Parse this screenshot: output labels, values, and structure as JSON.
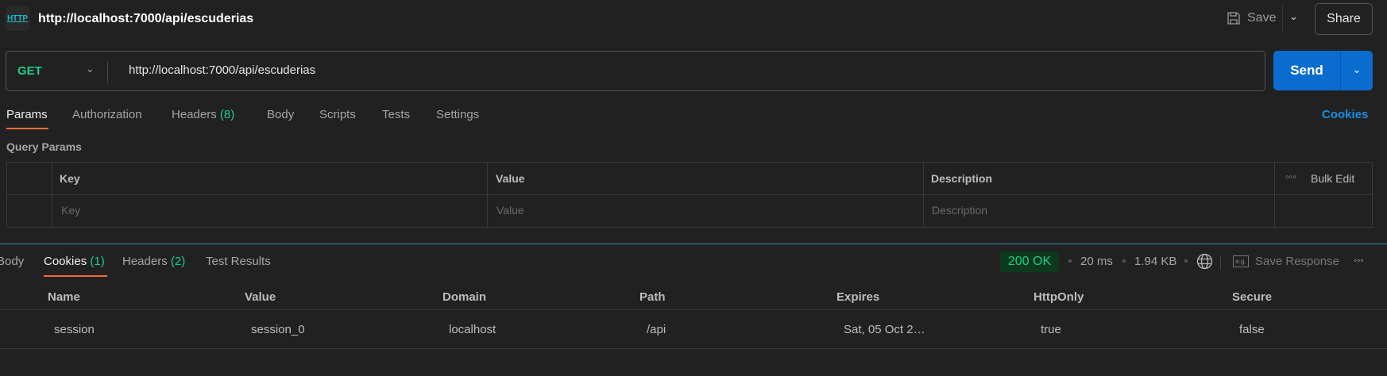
{
  "header": {
    "icon_text": "HTTP",
    "title": "http://localhost:7000/api/escuderias",
    "save_label": "Save",
    "share_label": "Share"
  },
  "request": {
    "method": "GET",
    "url": "http://localhost:7000/api/escuderias",
    "send_label": "Send"
  },
  "tabs": [
    {
      "label": "Params",
      "active": true
    },
    {
      "label": "Authorization"
    },
    {
      "label": "Headers",
      "count": "(8)"
    },
    {
      "label": "Body"
    },
    {
      "label": "Scripts"
    },
    {
      "label": "Tests"
    },
    {
      "label": "Settings"
    }
  ],
  "cookies_link": "Cookies",
  "query_params": {
    "title": "Query Params",
    "headers": [
      "Key",
      "Value",
      "Description"
    ],
    "bulk_edit": "Bulk Edit",
    "placeholders": [
      "Key",
      "Value",
      "Description"
    ]
  },
  "response": {
    "tabs": [
      {
        "label": "Body"
      },
      {
        "label": "Cookies",
        "count": "(1)",
        "active": true
      },
      {
        "label": "Headers",
        "count": "(2)"
      },
      {
        "label": "Test Results"
      }
    ],
    "status": "200 OK",
    "time": "20 ms",
    "size": "1.94 KB",
    "save_response": "Save Response",
    "status_color": "#1fcc8b",
    "cookies": {
      "headers": [
        "Name",
        "Value",
        "Domain",
        "Path",
        "Expires",
        "HttpOnly",
        "Secure"
      ],
      "rows": [
        [
          "session",
          "session_0",
          "localhost",
          "/api",
          "Sat, 05 Oct 2…",
          "true",
          "false"
        ]
      ]
    }
  }
}
